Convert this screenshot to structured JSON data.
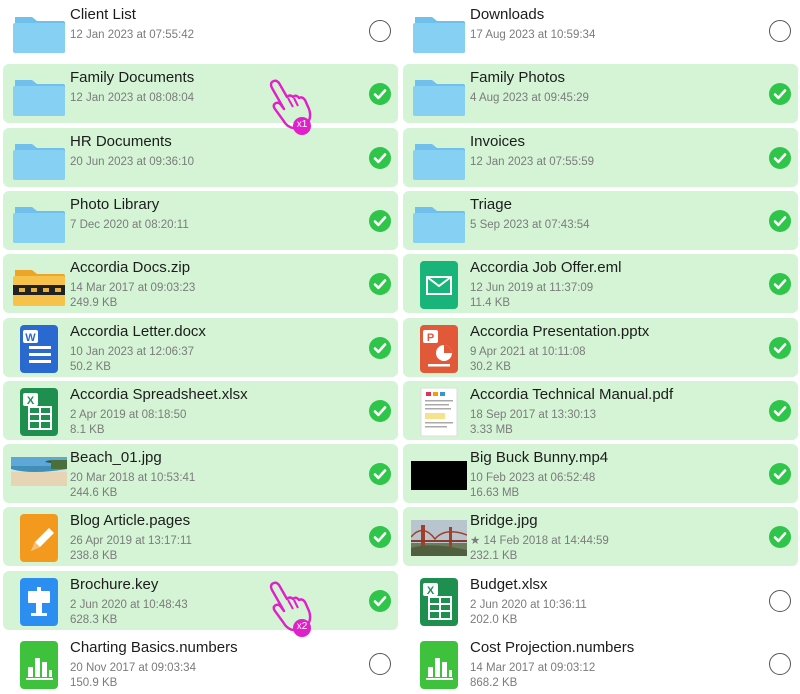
{
  "files": [
    {
      "name": "Client List",
      "date": "12 Jan 2023 at 07:55:42",
      "size": "",
      "icon": "folder-icon",
      "selected": false
    },
    {
      "name": "Downloads",
      "date": "17 Aug 2023 at 10:59:34",
      "size": "",
      "icon": "folder-icon",
      "selected": false
    },
    {
      "name": "Family Documents",
      "date": "12 Jan 2023 at 08:08:04",
      "size": "",
      "icon": "folder-icon",
      "selected": true
    },
    {
      "name": "Family Photos",
      "date": "4 Aug 2023 at 09:45:29",
      "size": "",
      "icon": "folder-icon",
      "selected": true
    },
    {
      "name": "HR Documents",
      "date": "20 Jun 2023 at 09:36:10",
      "size": "",
      "icon": "folder-icon",
      "selected": true
    },
    {
      "name": "Invoices",
      "date": "12 Jan 2023 at 07:55:59",
      "size": "",
      "icon": "folder-icon",
      "selected": true
    },
    {
      "name": "Photo Library",
      "date": "7 Dec 2020 at 08:20:11",
      "size": "",
      "icon": "folder-icon",
      "selected": true
    },
    {
      "name": "Triage",
      "date": "5 Sep 2023 at 07:43:54",
      "size": "",
      "icon": "folder-icon",
      "selected": true
    },
    {
      "name": "Accordia Docs.zip",
      "date": "14 Mar 2017 at 09:03:23",
      "size": "249.9 KB",
      "icon": "zip-icon",
      "selected": true
    },
    {
      "name": "Accordia Job Offer.eml",
      "date": "12 Jun 2019 at 11:37:09",
      "size": "11.4 KB",
      "icon": "email-icon",
      "selected": true
    },
    {
      "name": "Accordia Letter.docx",
      "date": "10 Jan 2023 at 12:06:37",
      "size": "50.2 KB",
      "icon": "word-icon",
      "selected": true
    },
    {
      "name": "Accordia Presentation.pptx",
      "date": "9 Apr 2021 at 10:11:08",
      "size": "30.2 KB",
      "icon": "powerpoint-icon",
      "selected": true
    },
    {
      "name": "Accordia Spreadsheet.xlsx",
      "date": "2 Apr 2019 at 08:18:50",
      "size": "8.1 KB",
      "icon": "excel-icon",
      "selected": true
    },
    {
      "name": "Accordia Technical Manual.pdf",
      "date": "18 Sep 2017 at 13:30:13",
      "size": "3.33 MB",
      "icon": "pdf-thumbnail-icon",
      "selected": true
    },
    {
      "name": "Beach_01.jpg",
      "date": "20 Mar 2018 at 10:53:41",
      "size": "244.6 KB",
      "icon": "beach-photo-icon",
      "selected": true
    },
    {
      "name": "Big Buck Bunny.mp4",
      "date": "10 Feb 2023 at 06:52:48",
      "size": "16.63 MB",
      "icon": "video-thumbnail-icon",
      "selected": true
    },
    {
      "name": "Blog Article.pages",
      "date": "26 Apr 2019 at 13:17:11",
      "size": "238.8 KB",
      "icon": "pages-icon",
      "selected": true
    },
    {
      "name": "Bridge.jpg",
      "date": "★ 14 Feb 2018 at 14:44:59",
      "size": "232.1 KB",
      "icon": "bridge-photo-icon",
      "selected": true
    },
    {
      "name": "Brochure.key",
      "date": "2 Jun 2020 at 10:48:43",
      "size": "628.3 KB",
      "icon": "keynote-icon",
      "selected": true
    },
    {
      "name": "Budget.xlsx",
      "date": "2 Jun 2020 at 10:36:11",
      "size": "202.0 KB",
      "icon": "excel-icon",
      "selected": false
    },
    {
      "name": "Charting Basics.numbers",
      "date": "20 Nov 2017 at 09:03:34",
      "size": "150.9 KB",
      "icon": "numbers-icon",
      "selected": false
    },
    {
      "name": "Cost Projection.numbers",
      "date": "14 Mar 2017 at 09:03:12",
      "size": "868.2 KB",
      "icon": "numbers-icon",
      "selected": false
    }
  ],
  "tap_indicators": [
    {
      "label": "x1",
      "icon": "tap-hand-icon",
      "color": "#e020c8"
    },
    {
      "label": "x2",
      "icon": "tap-hand-icon",
      "color": "#e020c8"
    }
  ],
  "colors": {
    "selected_row": "#d4f4d5",
    "checkmark": "#2fc44a",
    "folder": "#7dc8ef"
  }
}
